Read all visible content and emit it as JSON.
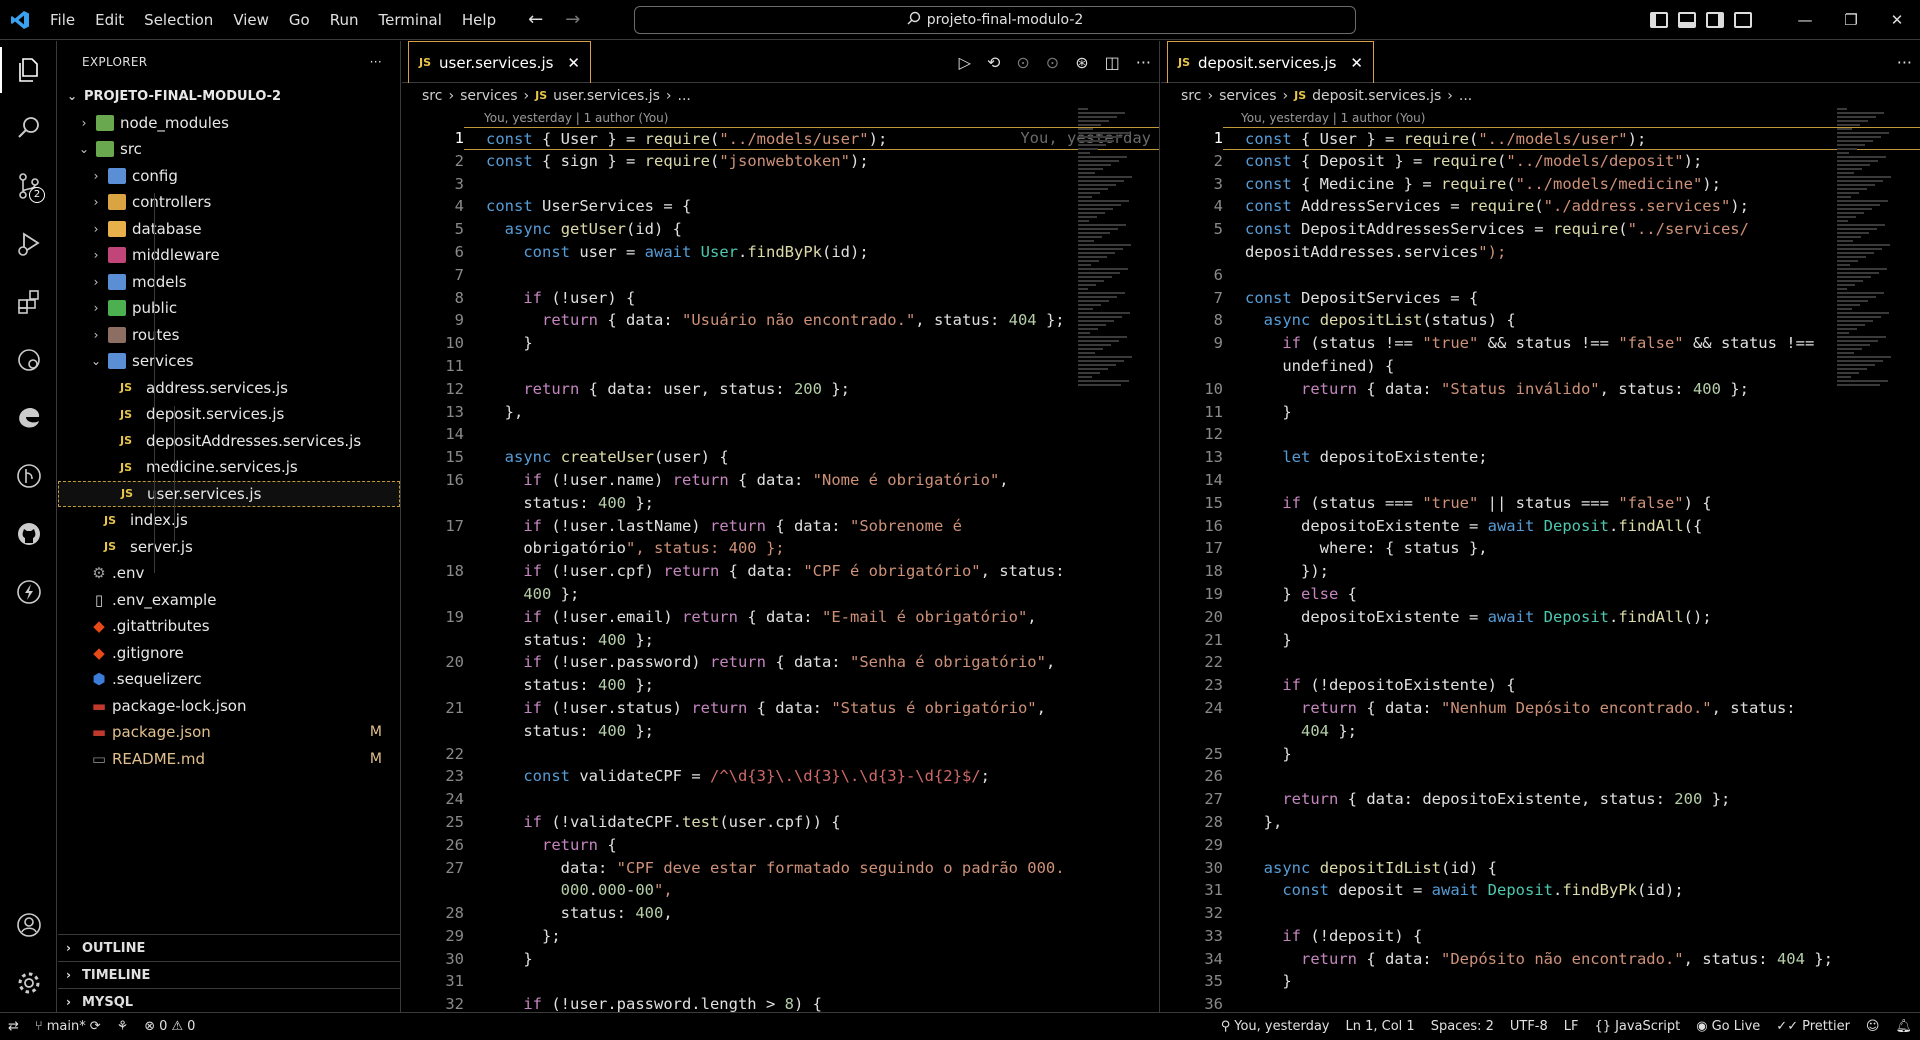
{
  "menu": [
    "File",
    "Edit",
    "Selection",
    "View",
    "Go",
    "Run",
    "Terminal",
    "Help"
  ],
  "command_center": "projeto-final-modulo-2",
  "activity": {
    "scm_badge": "2"
  },
  "explorer": {
    "title": "EXPLORER",
    "root": "PROJETO-FINAL-MODULO-2",
    "items": [
      {
        "label": "node_modules",
        "type": "folder",
        "depth": 1,
        "chev": "›",
        "color": "#6aa84f"
      },
      {
        "label": "src",
        "type": "folder",
        "depth": 1,
        "chev": "⌄",
        "color": "#6aa84f"
      },
      {
        "label": "config",
        "type": "folder",
        "depth": 2,
        "chev": "›",
        "color": "#5a8fd6"
      },
      {
        "label": "controllers",
        "type": "folder",
        "depth": 2,
        "chev": "›",
        "color": "#d9a441"
      },
      {
        "label": "database",
        "type": "folder",
        "depth": 2,
        "chev": "›",
        "color": "#e8b04a"
      },
      {
        "label": "middleware",
        "type": "folder",
        "depth": 2,
        "chev": "›",
        "color": "#c2457a"
      },
      {
        "label": "models",
        "type": "folder",
        "depth": 2,
        "chev": "›",
        "color": "#5a8fd6"
      },
      {
        "label": "public",
        "type": "folder",
        "depth": 2,
        "chev": "›",
        "color": "#4caf50"
      },
      {
        "label": "routes",
        "type": "folder",
        "depth": 2,
        "chev": "›",
        "color": "#8d6e63"
      },
      {
        "label": "services",
        "type": "folder",
        "depth": 2,
        "chev": "⌄",
        "color": "#5a8fd6"
      },
      {
        "label": "address.services.js",
        "type": "js",
        "depth": 3
      },
      {
        "label": "deposit.services.js",
        "type": "js",
        "depth": 3
      },
      {
        "label": "depositAddresses.services.js",
        "type": "js",
        "depth": 3
      },
      {
        "label": "medicine.services.js",
        "type": "js",
        "depth": 3
      },
      {
        "label": "user.services.js",
        "type": "js",
        "depth": 3,
        "selected": true
      },
      {
        "label": "index.js",
        "type": "js",
        "depth": 2
      },
      {
        "label": "server.js",
        "type": "js",
        "depth": 2
      },
      {
        "label": ".env",
        "type": "file",
        "depth": 1,
        "icon": "⚙",
        "color": "#9e9e9e"
      },
      {
        "label": ".env_example",
        "type": "file",
        "depth": 1,
        "icon": "▯",
        "color": "#cccccc"
      },
      {
        "label": ".gitattributes",
        "type": "file",
        "depth": 1,
        "icon": "◆",
        "color": "#e64a19"
      },
      {
        "label": ".gitignore",
        "type": "file",
        "depth": 1,
        "icon": "◆",
        "color": "#e64a19"
      },
      {
        "label": ".sequelizerc",
        "type": "file",
        "depth": 1,
        "icon": "⬢",
        "color": "#3b7dd8"
      },
      {
        "label": "package-lock.json",
        "type": "file",
        "depth": 1,
        "icon": "▬",
        "color": "#c0392b"
      },
      {
        "label": "package.json",
        "type": "file",
        "depth": 1,
        "icon": "▬",
        "color": "#c0392b",
        "modified": "M",
        "mod_color": "#e2c08d"
      },
      {
        "label": "README.md",
        "type": "file",
        "depth": 1,
        "icon": "▭",
        "color": "#888888",
        "modified": "M",
        "mod_color": "#e2c08d"
      }
    ],
    "sections": [
      "OUTLINE",
      "TIMELINE",
      "MYSQL"
    ]
  },
  "editor_left": {
    "tab": "user.services.js",
    "breadcrumb": [
      "src",
      "services",
      "user.services.js",
      "..."
    ],
    "blame_header": "You, yesterday | 1 author (You)",
    "ghost": "You, yesterday",
    "lines": [
      {
        "n": "1",
        "t": "const { User } = require(\"../models/user\");"
      },
      {
        "n": "2",
        "t": "const { sign } = require(\"jsonwebtoken\");"
      },
      {
        "n": "3",
        "t": ""
      },
      {
        "n": "4",
        "t": "const UserServices = {"
      },
      {
        "n": "5",
        "t": "  async getUser(id) {"
      },
      {
        "n": "6",
        "t": "    const user = await User.findByPk(id);"
      },
      {
        "n": "7",
        "t": ""
      },
      {
        "n": "8",
        "t": "    if (!user) {"
      },
      {
        "n": "9",
        "t": "      return { data: \"Usuário não encontrado.\", status: 404 };"
      },
      {
        "n": "10",
        "t": "    }"
      },
      {
        "n": "11",
        "t": ""
      },
      {
        "n": "12",
        "t": "    return { data: user, status: 200 };"
      },
      {
        "n": "13",
        "t": "  },"
      },
      {
        "n": "14",
        "t": ""
      },
      {
        "n": "15",
        "t": "  async createUser(user) {"
      },
      {
        "n": "16",
        "t": "    if (!user.name) return { data: \"Nome é obrigatório\","
      },
      {
        "n": "",
        "t": "    status: 400 };"
      },
      {
        "n": "17",
        "t": "    if (!user.lastName) return { data: \"Sobrenome é"
      },
      {
        "n": "",
        "t": "    obrigatório\", status: 400 };"
      },
      {
        "n": "18",
        "t": "    if (!user.cpf) return { data: \"CPF é obrigatório\", status:"
      },
      {
        "n": "",
        "t": "    400 };"
      },
      {
        "n": "19",
        "t": "    if (!user.email) return { data: \"E-mail é obrigatório\","
      },
      {
        "n": "",
        "t": "    status: 400 };"
      },
      {
        "n": "20",
        "t": "    if (!user.password) return { data: \"Senha é obrigatório\","
      },
      {
        "n": "",
        "t": "    status: 400 };"
      },
      {
        "n": "21",
        "t": "    if (!user.status) return { data: \"Status é obrigatório\","
      },
      {
        "n": "",
        "t": "    status: 400 };"
      },
      {
        "n": "22",
        "t": ""
      },
      {
        "n": "23",
        "t": "    const validateCPF = /^\\d{3}\\.\\d{3}\\.\\d{3}-\\d{2}$/;"
      },
      {
        "n": "24",
        "t": ""
      },
      {
        "n": "25",
        "t": "    if (!validateCPF.test(user.cpf)) {"
      },
      {
        "n": "26",
        "t": "      return {"
      },
      {
        "n": "27",
        "t": "        data: \"CPF deve estar formatado seguindo o padrão 000."
      },
      {
        "n": "",
        "t": "        000.000-00\","
      },
      {
        "n": "28",
        "t": "        status: 400,"
      },
      {
        "n": "29",
        "t": "      };"
      },
      {
        "n": "30",
        "t": "    }"
      },
      {
        "n": "31",
        "t": ""
      },
      {
        "n": "32",
        "t": "    if (!user.password.length > 8) {"
      }
    ]
  },
  "editor_right": {
    "tab": "deposit.services.js",
    "breadcrumb": [
      "src",
      "services",
      "deposit.services.js",
      "..."
    ],
    "blame_header": "You, yesterday | 1 author (You)",
    "lines": [
      {
        "n": "1",
        "t": "const { User } = require(\"../models/user\");"
      },
      {
        "n": "2",
        "t": "const { Deposit } = require(\"../models/deposit\");"
      },
      {
        "n": "3",
        "t": "const { Medicine } = require(\"../models/medicine\");"
      },
      {
        "n": "4",
        "t": "const AddressServices = require(\"./address.services\");"
      },
      {
        "n": "5",
        "t": "const DepositAddressesServices = require(\"../services/"
      },
      {
        "n": "",
        "t": "depositAddresses.services\");"
      },
      {
        "n": "6",
        "t": ""
      },
      {
        "n": "7",
        "t": "const DepositServices = {"
      },
      {
        "n": "8",
        "t": "  async depositList(status) {"
      },
      {
        "n": "9",
        "t": "    if (status !== \"true\" && status !== \"false\" && status !=="
      },
      {
        "n": "",
        "t": "    undefined) {"
      },
      {
        "n": "10",
        "t": "      return { data: \"Status inválido\", status: 400 };"
      },
      {
        "n": "11",
        "t": "    }"
      },
      {
        "n": "12",
        "t": ""
      },
      {
        "n": "13",
        "t": "    let depositoExistente;"
      },
      {
        "n": "14",
        "t": ""
      },
      {
        "n": "15",
        "t": "    if (status === \"true\" || status === \"false\") {"
      },
      {
        "n": "16",
        "t": "      depositoExistente = await Deposit.findAll({"
      },
      {
        "n": "17",
        "t": "        where: { status },"
      },
      {
        "n": "18",
        "t": "      });"
      },
      {
        "n": "19",
        "t": "    } else {"
      },
      {
        "n": "20",
        "t": "      depositoExistente = await Deposit.findAll();"
      },
      {
        "n": "21",
        "t": "    }"
      },
      {
        "n": "22",
        "t": ""
      },
      {
        "n": "23",
        "t": "    if (!depositoExistente) {"
      },
      {
        "n": "24",
        "t": "      return { data: \"Nenhum Depósito encontrado.\", status:"
      },
      {
        "n": "",
        "t": "      404 };"
      },
      {
        "n": "25",
        "t": "    }"
      },
      {
        "n": "26",
        "t": ""
      },
      {
        "n": "27",
        "t": "    return { data: depositoExistente, status: 200 };"
      },
      {
        "n": "28",
        "t": "  },"
      },
      {
        "n": "29",
        "t": ""
      },
      {
        "n": "30",
        "t": "  async depositIdList(id) {"
      },
      {
        "n": "31",
        "t": "    const deposit = await Deposit.findByPk(id);"
      },
      {
        "n": "32",
        "t": ""
      },
      {
        "n": "33",
        "t": "    if (!deposit) {"
      },
      {
        "n": "34",
        "t": "      return { data: \"Depósito não encontrado.\", status: 404 };"
      },
      {
        "n": "35",
        "t": "    }"
      },
      {
        "n": "36",
        "t": ""
      }
    ]
  },
  "status": {
    "branch": "main*",
    "errors": "0",
    "warnings": "0",
    "blame": "You, yesterday",
    "position": "Ln 1, Col 1",
    "spaces": "Spaces: 2",
    "encoding": "UTF-8",
    "eol": "LF",
    "language": "JavaScript",
    "golive": "Go Live",
    "prettier": "Prettier"
  }
}
